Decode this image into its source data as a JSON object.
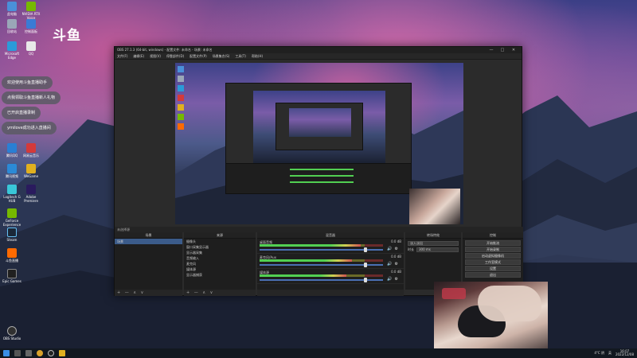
{
  "desktop": {
    "logo_text": "斗鱼",
    "icons": [
      {
        "label": "此电脑",
        "color": "#4a90d9"
      },
      {
        "label": "NVIDIA RTX Voice",
        "color": "#76b900"
      },
      {
        "label": "回收站",
        "color": "#9aa7b8"
      },
      {
        "label": "控制面板",
        "color": "#3a7bd5"
      },
      {
        "label": "Microsoft Edge",
        "color": "#2b9bd8"
      },
      {
        "label": "QQ",
        "color": "#e8e8e8"
      },
      {
        "label": "腾讯QQ",
        "color": "#2a7fd4"
      },
      {
        "label": "网易云音乐",
        "color": "#d43a3a"
      },
      {
        "label": "腾讯视频",
        "color": "#2b8ad6"
      },
      {
        "label": "WeGame",
        "color": "#e0b020"
      },
      {
        "label": "Logitech G HUB",
        "color": "#39c7d8"
      },
      {
        "label": "Adobe Premiere",
        "color": "#2a1b5e"
      },
      {
        "label": "GeForce Experience",
        "color": "#76b900"
      },
      {
        "label": "Steam",
        "color": "#1b2838"
      },
      {
        "label": "斗鱼直播",
        "color": "#ff6a00"
      },
      {
        "label": "Epic Games",
        "color": "#202020"
      },
      {
        "label": "OBS Studio",
        "color": "#303030"
      }
    ],
    "toasts": [
      "欢迎使用斗鱼直播助手",
      "点我领取斗鱼直播新人礼物",
      "已开启直播录制",
      "ymilove成功进入直播间"
    ]
  },
  "obs": {
    "title": "OBS 27.1.3 (64-bit, windows) - 配置文件: 未命名 - 场景: 未命名",
    "window_buttons": {
      "minimize": "—",
      "maximize": "□",
      "close": "✕"
    },
    "menu": [
      "文件(F)",
      "编辑(E)",
      "视图(V)",
      "停靠部件(D)",
      "配置文件(P)",
      "场景集合(S)",
      "工具(T)",
      "帮助(H)"
    ],
    "source_label": "未选择源",
    "docks": {
      "scenes": {
        "title": "场景",
        "items": [
          "场景"
        ]
      },
      "sources": {
        "title": "来源",
        "items": [
          "摄像头",
          "窗口采集显示器",
          "显示器采集",
          "音频输入",
          "麦克风",
          "媒体源",
          "显示器捕获"
        ]
      },
      "mixer": {
        "title": "混音器",
        "channels": [
          {
            "name": "桌面音频",
            "db": "0.0 dB",
            "level": 0.82,
            "volume": 0.86
          },
          {
            "name": "麦克风/Aux",
            "db": "0.0 dB",
            "level": 0.75,
            "volume": 0.86
          },
          {
            "name": "媒体源",
            "db": "0.0 dB",
            "level": 0.7,
            "volume": 0.86
          }
        ]
      },
      "transitions": {
        "title": "转场特效",
        "type_label": "淡入淡出",
        "duration_label": "时长",
        "duration_value": "300 ms"
      },
      "controls": {
        "title": "控制",
        "buttons": [
          "开始推流",
          "开始录制",
          "启动虚拟摄像机",
          "工作室模式",
          "设置",
          "退出"
        ]
      }
    },
    "footer_glyphs": "+ — ∧ ∨"
  },
  "taskbar": {
    "tray_text": "4°C 阴",
    "time": "16:07",
    "date": "2022/12/08",
    "lang": "英"
  }
}
